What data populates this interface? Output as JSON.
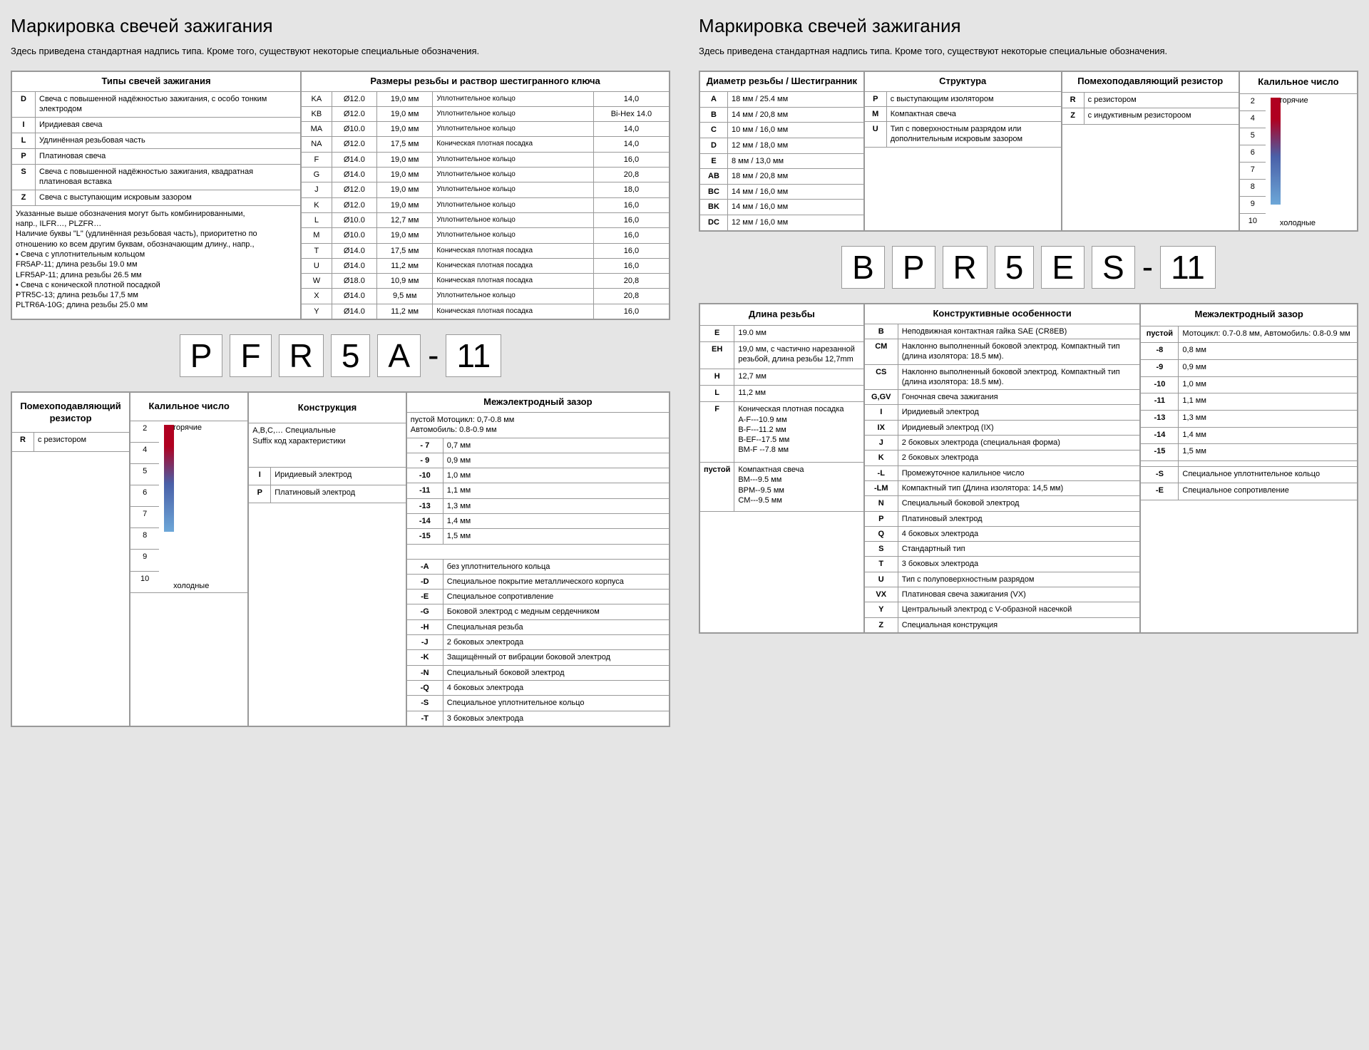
{
  "title": "Маркировка свечей зажигания",
  "sub": "Здесь приведена стандартная надпись типа. Кроме того, существуют некоторые специальные обозначения.",
  "left": {
    "code": [
      "P",
      "F",
      "R",
      "5",
      "A",
      "-",
      "11"
    ],
    "hdr_types": "Типы свечей зажигания",
    "hdr_thread": "Размеры резьбы и раствор шестигранного ключа",
    "types": [
      [
        "D",
        "Свеча с повышенной надёжностью зажигания, с особо тонким электродом"
      ],
      [
        "I",
        "Иридиевая свеча"
      ],
      [
        "L",
        "Удлинённая резьбовая часть"
      ],
      [
        "P",
        "Платиновая свеча"
      ],
      [
        "S",
        "Свеча с повышенной надёжностью зажигания, квадратная платиновая вставка"
      ],
      [
        "Z",
        "Свеча с выступающим искровым зазором"
      ]
    ],
    "types_note": "Указанные выше обозначения могут быть комбинированными,\nнапр., ILFR…, PLZFR…\nНаличие буквы \"L\" (удлинённая резьбовая часть), приоритетно по отношению ко всем другим буквам, обозначающим длину., напр.,\n• Свеча с уплотнительным кольцом\n  FR5AP-11; длина резьбы 19.0 мм\n  LFR5AP-11; длина резьбы 26.5 мм\n• Свеча с конической плотной посадкой\n  PTR5C-13; длина резьбы 17,5 мм\n  PLTR6A-10G; длина резьбы 25.0 мм",
    "thread": [
      [
        "KA",
        "Ø12.0",
        "19,0 мм",
        "Уплотнительное кольцо",
        "14,0"
      ],
      [
        "KB",
        "Ø12.0",
        "19,0 мм",
        "Уплотнительное кольцо",
        "Bi-Hex 14.0"
      ],
      [
        "MA",
        "Ø10.0",
        "19,0 мм",
        "Уплотнительное кольцо",
        "14,0"
      ],
      [
        "NA",
        "Ø12.0",
        "17,5 мм",
        "Коническая плотная посадка",
        "14,0"
      ],
      [
        "F",
        "Ø14.0",
        "19,0 мм",
        "Уплотнительное кольцо",
        "16,0"
      ],
      [
        "G",
        "Ø14.0",
        "19,0 мм",
        "Уплотнительное кольцо",
        "20,8"
      ],
      [
        "J",
        "Ø12.0",
        "19,0 мм",
        "Уплотнительное кольцо",
        "18,0"
      ],
      [
        "K",
        "Ø12.0",
        "19,0 мм",
        "Уплотнительное кольцо",
        "16,0"
      ],
      [
        "L",
        "Ø10.0",
        "12,7 мм",
        "Уплотнительное кольцо",
        "16,0"
      ],
      [
        "M",
        "Ø10.0",
        "19,0 мм",
        "Уплотнительное кольцо",
        "16,0"
      ],
      [
        "T",
        "Ø14.0",
        "17,5 мм",
        "Коническая плотная посадка",
        "16,0"
      ],
      [
        "U",
        "Ø14.0",
        "11,2 мм",
        "Коническая плотная посадка",
        "16,0"
      ],
      [
        "W",
        "Ø18.0",
        "10,9 мм",
        "Коническая плотная посадка",
        "20,8"
      ],
      [
        "X",
        "Ø14.0",
        "9,5 мм",
        "Уплотнительное кольцо",
        "20,8"
      ],
      [
        "Y",
        "Ø14.0",
        "11,2 мм",
        "Коническая плотная посадка",
        "16,0"
      ]
    ],
    "hdr_res": "Помехоподавляющий резистор",
    "res": [
      [
        "R",
        "с резистором"
      ]
    ],
    "hdr_heat": "Калильное число",
    "heat_hot": "горячие",
    "heat_cold": "холодные",
    "heat_vals": [
      "2",
      "4",
      "5",
      "6",
      "7",
      "8",
      "9",
      "10"
    ],
    "hdr_cons": "Конструкция",
    "cons_note": "A,B,C,…  Специальные\nSuffix код  характеристики",
    "cons": [
      [
        "I",
        "Иридиевый электрод"
      ],
      [
        "P",
        "Платиновый электрод"
      ]
    ],
    "hdr_gap": "Межэлектродный зазор",
    "gap_top": "пустой   Мотоцикл: 0,7-0.8 мм\n           Автомобиль: 0.8-0.9 мм",
    "gap": [
      [
        "- 7",
        "0,7 мм"
      ],
      [
        "- 9",
        "0,9 мм"
      ],
      [
        "-10",
        "1,0 мм"
      ],
      [
        "-11",
        "1,1 мм"
      ],
      [
        "-13",
        "1,3 мм"
      ],
      [
        "-14",
        "1,4 мм"
      ],
      [
        "-15",
        "1,5 мм"
      ]
    ],
    "gap_suffix": [
      [
        "-A",
        "без уплотнительного кольца"
      ],
      [
        "-D",
        "Специальное покрытие металлического корпуса"
      ],
      [
        "-E",
        "Специальное сопротивление"
      ],
      [
        "-G",
        "Боковой электрод с медным сердечником"
      ],
      [
        "-H",
        "Специальная резьба"
      ],
      [
        "-J",
        "2 боковых электрода"
      ],
      [
        "-K",
        "Защищённый от вибрации боковой электрод"
      ],
      [
        "-N",
        "Специальный боковой электрод"
      ],
      [
        "-Q",
        "4 боковых электрода"
      ],
      [
        "-S",
        "Специальное уплотнительное кольцо"
      ],
      [
        "-T",
        "3 боковых электрода"
      ]
    ]
  },
  "right": {
    "code": [
      "B",
      "P",
      "R",
      "5",
      "E",
      "S",
      "-",
      "11"
    ],
    "hdr_dia": "Диаметр резьбы / Шестигранник",
    "dia": [
      [
        "A",
        "18 мм / 25.4 мм"
      ],
      [
        "B",
        "14 мм / 20,8 мм"
      ],
      [
        "C",
        "10 мм / 16,0 мм"
      ],
      [
        "D",
        "12 мм / 18,0 мм"
      ],
      [
        "E",
        "8 мм / 13,0 мм"
      ],
      [
        "AB",
        "18 мм / 20,8 мм"
      ],
      [
        "BC",
        "14 мм / 16,0 мм"
      ],
      [
        "BK",
        "14 мм / 16,0 мм"
      ],
      [
        "DC",
        "12 мм / 16,0 мм"
      ]
    ],
    "hdr_struct": "Структура",
    "struct": [
      [
        "P",
        "с выступающим изолятором"
      ],
      [
        "M",
        "Компактная свеча"
      ],
      [
        "U",
        "Тип с поверхностным разрядом или дополнительным искровым зазором"
      ]
    ],
    "hdr_res": "Помехоподавляющий резистор",
    "res": [
      [
        "R",
        "с резистором"
      ],
      [
        "Z",
        "с индуктивным резистороом"
      ]
    ],
    "hdr_heat": "Калильное число",
    "heat_vals": [
      "2",
      "4",
      "5",
      "6",
      "7",
      "8",
      "9",
      "10"
    ],
    "heat_hot": "горячие",
    "heat_cold": "холодные",
    "hdr_len": "Длина резьбы",
    "len": [
      [
        "E",
        "19.0 мм"
      ],
      [
        "EH",
        "19,0 мм, с частично нарезанной резьбой, длина резьбы 12,7mm"
      ],
      [
        "H",
        "12,7 мм"
      ],
      [
        "L",
        "11,2 мм"
      ],
      [
        "F",
        "Коническая плотная посадка\nA-F---10.9 мм\nB-F---11.2 мм\nB-EF--17.5 мм\nBM-F --7.8 мм"
      ],
      [
        "пустой",
        "Компактная свеча\nBM---9.5 мм\nBPM--9.5 мм\nCM---9.5 мм"
      ]
    ],
    "hdr_feat": "Конструктивные особенности",
    "feat": [
      [
        "B",
        "Неподвижная контактная гайка SAE (CR8EB)"
      ],
      [
        "CM",
        "Наклонно выполненный боковой электрод. Компактный тип (длина изолятора: 18.5 мм)."
      ],
      [
        "CS",
        "Наклонно выполненный боковой электрод. Компактный тип (длина изолятора: 18.5 мм)."
      ],
      [
        "G,GV",
        "Гоночная свеча зажигания"
      ],
      [
        "I",
        "Иридиевый электрод"
      ],
      [
        "IX",
        "Иридиевый электрод (IX)"
      ],
      [
        "J",
        "2 боковых электрода (специальная форма)"
      ],
      [
        "K",
        "2 боковых электрода"
      ],
      [
        "-L",
        "Промежуточное калильное число"
      ],
      [
        "-LM",
        "Компактный тип (Длина изолятора: 14,5 мм)"
      ],
      [
        "N",
        "Специальный боковой электрод"
      ],
      [
        "P",
        "Платиновый электрод"
      ],
      [
        "Q",
        "4 боковых электрода"
      ],
      [
        "S",
        "Стандартный тип"
      ],
      [
        "T",
        "3 боковых электрода"
      ],
      [
        "U",
        "Тип с полуповерхностным разрядом"
      ],
      [
        "VX",
        "Платиновая свеча зажигания (VX)"
      ],
      [
        "Y",
        "Центральный электрод с V-образной насечкой"
      ],
      [
        "Z",
        "Специальная конструкция"
      ]
    ],
    "hdr_gap": "Межэлектродный зазор",
    "gap": [
      [
        "пустой",
        "Мотоцикл: 0.7-0.8 мм, Автомобиль: 0.8-0.9 мм"
      ],
      [
        "-8",
        "0,8 мм"
      ],
      [
        "-9",
        "0,9 мм"
      ],
      [
        "-10",
        "1,0 мм"
      ],
      [
        "-11",
        "1,1 мм"
      ],
      [
        "-13",
        "1,3 мм"
      ],
      [
        "-14",
        "1,4 мм"
      ],
      [
        "-15",
        "1,5 мм"
      ],
      [
        "",
        ""
      ],
      [
        "-S",
        "Специальное уплотнительное кольцо"
      ],
      [
        "-E",
        "Специальное сопротивление"
      ]
    ]
  }
}
